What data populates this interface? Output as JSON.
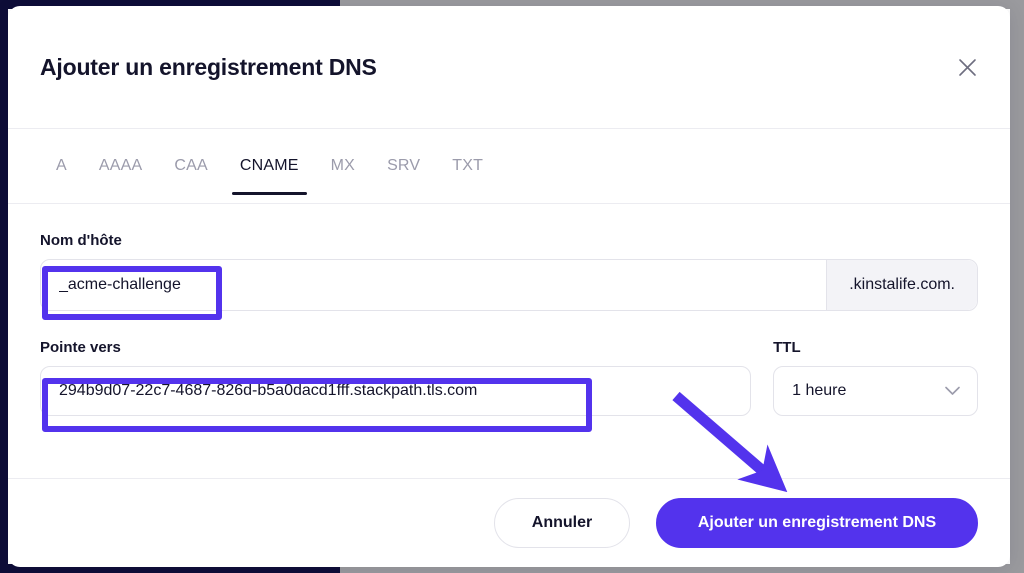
{
  "modal": {
    "title": "Ajouter un enregistrement DNS",
    "close_icon": "close-icon"
  },
  "tabs": [
    {
      "label": "A",
      "active": false
    },
    {
      "label": "AAAA",
      "active": false
    },
    {
      "label": "CAA",
      "active": false
    },
    {
      "label": "CNAME",
      "active": true
    },
    {
      "label": "MX",
      "active": false
    },
    {
      "label": "SRV",
      "active": false
    },
    {
      "label": "TXT",
      "active": false
    }
  ],
  "form": {
    "hostname": {
      "label": "Nom d'hôte",
      "value": "_acme-challenge",
      "placeholder": "",
      "suffix": ".kinstalife.com."
    },
    "points_to": {
      "label": "Pointe vers",
      "value": "294b9d07-22c7-4687-826d-b5a0dacd1fff.stackpath.tls.com",
      "placeholder": ""
    },
    "ttl": {
      "label": "TTL",
      "value": "1 heure",
      "chevron_icon": "chevron-down-icon",
      "options": [
        "1 heure"
      ]
    }
  },
  "footer": {
    "cancel_label": "Annuler",
    "submit_label": "Ajouter un enregistrement DNS"
  },
  "annotations": {
    "accent_color": "#5333ed",
    "hostname_highlight": true,
    "points_to_highlight": true,
    "arrow_to_submit": true
  },
  "colors": {
    "accent": "#5333ed",
    "chrome_navy": "#0e0d38",
    "page_background": "#9a9a9e",
    "text_primary": "#14142b",
    "text_muted": "#9b9bab",
    "field_border": "#e3e3ea",
    "suffix_background": "#f3f3f7"
  }
}
